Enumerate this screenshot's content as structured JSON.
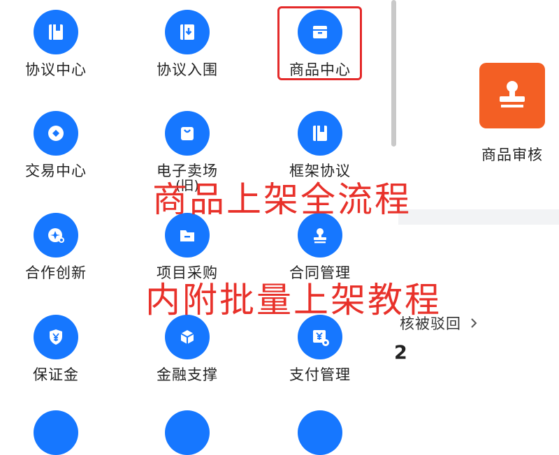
{
  "grid": {
    "items": [
      {
        "label": "协议中心",
        "icon": "book-icon"
      },
      {
        "label": "协议入围",
        "icon": "download-doc-icon"
      },
      {
        "label": "商品中心",
        "icon": "box-icon"
      },
      {
        "label": "交易中心",
        "icon": "coin-icon"
      },
      {
        "label": "电子卖场",
        "sub": "(旧)",
        "icon": "shopping-bag-icon"
      },
      {
        "label": "框架协议",
        "icon": "book-icon"
      },
      {
        "label": "合作创新",
        "icon": "rocket-icon"
      },
      {
        "label": "项目采购",
        "icon": "folder-icon"
      },
      {
        "label": "合同管理",
        "icon": "stamp-icon"
      },
      {
        "label": "保证金",
        "icon": "yen-shield-icon"
      },
      {
        "label": "金融支撑",
        "icon": "cube-icon"
      },
      {
        "label": "支付管理",
        "icon": "yen-gear-icon"
      }
    ]
  },
  "right_panel": {
    "audit_label": "商品审核",
    "audit_icon": "stamp-icon",
    "reject_label": "核被驳回",
    "reject_count": "2"
  },
  "overlay": {
    "line1": "商品上架全流程",
    "line2": "内附批量上架教程"
  },
  "colors": {
    "icon_blue": "#1677ff",
    "highlight_red": "#e42a2a",
    "overlay_red": "#e8312a",
    "audit_orange": "#f35f24"
  }
}
